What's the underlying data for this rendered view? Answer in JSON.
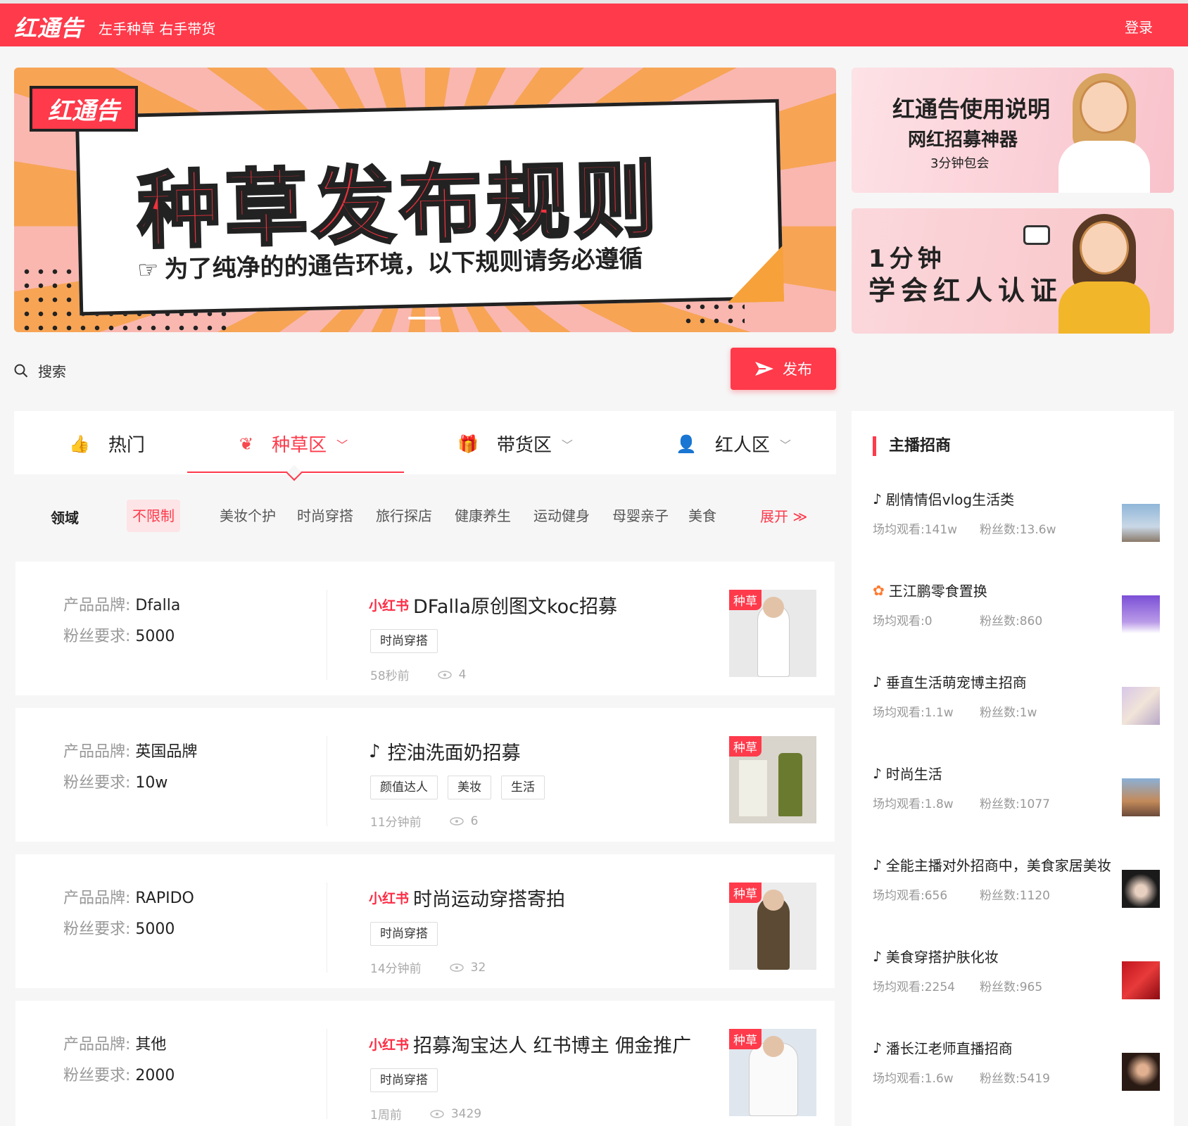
{
  "header": {
    "logo": "红通告",
    "slogan": "左手种草 右手带货",
    "login": "登录"
  },
  "banner": {
    "badge": "红通告",
    "title": "种草发布规则",
    "subtitle": "为了纯净的的通告环境，以下规则请务必遵循"
  },
  "side_banners": [
    {
      "line1": "红通告使用说明",
      "line2": "网红招募神器",
      "line3": "3分钟包会"
    },
    {
      "line1": "1分钟",
      "line2": "学会红人认证"
    }
  ],
  "search": {
    "label": "搜索"
  },
  "publish": {
    "label": "发布"
  },
  "tabs": [
    {
      "label": "热门",
      "icon": "thumbs-up-icon"
    },
    {
      "label": "种草区",
      "icon": "sprout-icon"
    },
    {
      "label": "带货区",
      "icon": "gift-icon"
    },
    {
      "label": "红人区",
      "icon": "person-icon"
    }
  ],
  "filter": {
    "label": "领域",
    "options": [
      "不限制",
      "美妆个护",
      "时尚穿搭",
      "旅行探店",
      "健康养生",
      "运动健身",
      "母婴亲子",
      "美食"
    ],
    "expand": "展开"
  },
  "cards": [
    {
      "brand_label": "产品品牌:",
      "brand": "Dfalla",
      "fans_label": "粉丝要求:",
      "fans": "5000",
      "platform": "小红书",
      "title": "DFalla原创图文koc招募",
      "tags": [
        "时尚穿搭"
      ],
      "time": "58秒前",
      "views": "4",
      "badge": "种草"
    },
    {
      "brand_label": "产品品牌:",
      "brand": "英国品牌",
      "fans_label": "粉丝要求:",
      "fans": "10w",
      "platform": "抖音",
      "title": "控油洗面奶招募",
      "tags": [
        "颜值达人",
        "美妆",
        "生活"
      ],
      "time": "11分钟前",
      "views": "6",
      "badge": "种草"
    },
    {
      "brand_label": "产品品牌:",
      "brand": "RAPIDO",
      "fans_label": "粉丝要求:",
      "fans": "5000",
      "platform": "小红书",
      "title": "时尚运动穿搭寄拍",
      "tags": [
        "时尚穿搭"
      ],
      "time": "14分钟前",
      "views": "32",
      "badge": "种草"
    },
    {
      "brand_label": "产品品牌:",
      "brand": "其他",
      "fans_label": "粉丝要求:",
      "fans": "2000",
      "platform": "小红书",
      "title": "招募淘宝达人 红书博主 佣金推广",
      "tags": [
        "时尚穿搭"
      ],
      "time": "1周前",
      "views": "3429",
      "badge": "种草"
    }
  ],
  "anchors": {
    "title": "主播招商",
    "items": [
      {
        "name": "剧情情侣vlog生活类",
        "views": "场均观看:141w",
        "fans": "粉丝数:13.6w",
        "platform": "douyin"
      },
      {
        "name": "王江鹏零食置换",
        "views": "场均观看:0",
        "fans": "粉丝数:860",
        "platform": "kuaishou"
      },
      {
        "name": "垂直生活萌宠博主招商",
        "views": "场均观看:1.1w",
        "fans": "粉丝数:1w",
        "platform": "douyin"
      },
      {
        "name": "时尚生活",
        "views": "场均观看:1.8w",
        "fans": "粉丝数:1077",
        "platform": "douyin"
      },
      {
        "name": "全能主播对外招商中，美食家居美妆",
        "views": "场均观看:656",
        "fans": "粉丝数:1120",
        "platform": "douyin"
      },
      {
        "name": "美食穿搭护肤化妆",
        "views": "场均观看:2254",
        "fans": "粉丝数:965",
        "platform": "douyin"
      },
      {
        "name": "潘长江老师直播招商",
        "views": "场均观看:1.6w",
        "fans": "粉丝数:5419",
        "platform": "douyin"
      }
    ]
  },
  "colors": {
    "brand": "#fe3a4b",
    "background": "#f6f6f6"
  }
}
